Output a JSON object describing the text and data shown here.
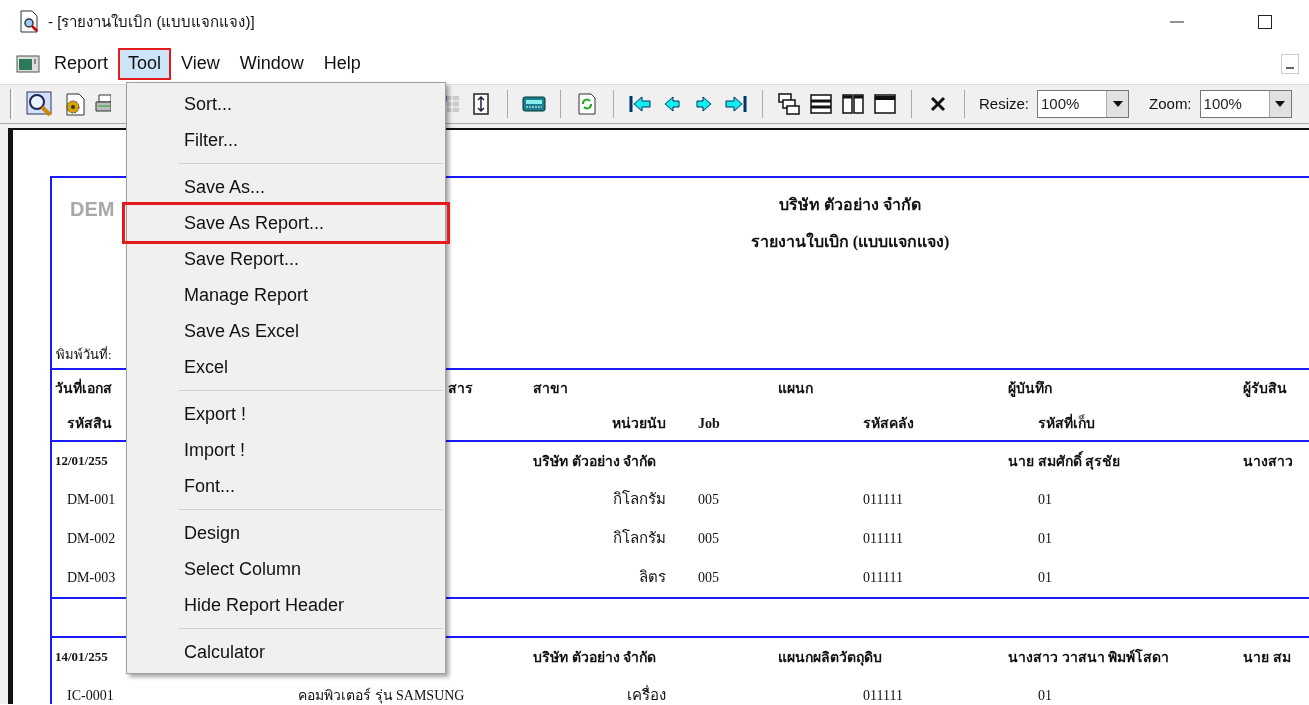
{
  "window": {
    "title": "- [รายงานใบเบิก (แบบแจกแจง)]"
  },
  "menu_bar": {
    "items": [
      {
        "label": "Report",
        "selected": false,
        "highlighted": false
      },
      {
        "label": "Tool",
        "selected": true,
        "highlighted": true
      },
      {
        "label": "View",
        "selected": false,
        "highlighted": false
      },
      {
        "label": "Window",
        "selected": false,
        "highlighted": false
      },
      {
        "label": "Help",
        "selected": false,
        "highlighted": false
      }
    ]
  },
  "dropdown_menu": {
    "items": [
      {
        "kind": "item",
        "label": "Sort...",
        "highlighted": false
      },
      {
        "kind": "item",
        "label": "Filter...",
        "highlighted": false
      },
      {
        "kind": "separator"
      },
      {
        "kind": "item",
        "label": "Save As...",
        "highlighted": false
      },
      {
        "kind": "item",
        "label": "Save As Report...",
        "highlighted": true
      },
      {
        "kind": "item",
        "label": "Save Report...",
        "highlighted": false
      },
      {
        "kind": "item",
        "label": "Manage Report",
        "highlighted": false
      },
      {
        "kind": "item",
        "label": "Save As Excel",
        "highlighted": false
      },
      {
        "kind": "item",
        "label": "Excel",
        "highlighted": false
      },
      {
        "kind": "separator"
      },
      {
        "kind": "item",
        "label": "Export !",
        "highlighted": false
      },
      {
        "kind": "item",
        "label": "Import !",
        "highlighted": false
      },
      {
        "kind": "item",
        "label": "Font...",
        "highlighted": false
      },
      {
        "kind": "separator"
      },
      {
        "kind": "item",
        "label": "Design",
        "highlighted": false
      },
      {
        "kind": "item",
        "label": "Select Column",
        "highlighted": false
      },
      {
        "kind": "item",
        "label": "Hide Report Header",
        "highlighted": false
      },
      {
        "kind": "separator"
      },
      {
        "kind": "item",
        "label": "Calculator",
        "highlighted": false
      }
    ]
  },
  "toolbar": {
    "resize": {
      "label": "Resize:",
      "value": "100%"
    },
    "zoom": {
      "label": "Zoom:",
      "value": "100%"
    }
  },
  "report": {
    "logo_text": "DEM",
    "company": "บริษัท ตัวอย่าง จำกัด",
    "title": "รายงานใบเบิก (แบบแจกแจง)",
    "print_date_label": "พิมพ์วันที่:",
    "header_rows": [
      {
        "column_1": "วันที่เอกส",
        "column_2": "สาร",
        "branch": "สาขา",
        "department": "แผนก",
        "recorder": "ผู้บันทึก",
        "column_7": "ผู้รับสิน"
      },
      {
        "column_1_sub": "รหัสสิน",
        "unit": "หน่วยนับ",
        "job": "Job",
        "warehouse_code": "รหัสคลัง",
        "location_code": "รหัสที่เก็บ"
      }
    ],
    "groups": [
      {
        "header": {
          "date": "12/01/255",
          "branch": "บริษัท ตัวอย่าง จำกัด",
          "recorder": "นาย สมศักดิ์  สุรชัย",
          "receiver": "นางสาว"
        },
        "lines": [
          {
            "code": "DM-001",
            "unit": "กิโลกรัม",
            "job": "005",
            "warehouse_code": "011111",
            "location_code": "01"
          },
          {
            "code": "DM-002",
            "unit": "กิโลกรัม",
            "job": "005",
            "warehouse_code": "011111",
            "location_code": "01"
          },
          {
            "code": "DM-003",
            "unit": "ลิตร",
            "job": "005",
            "warehouse_code": "011111",
            "location_code": "01"
          }
        ]
      },
      {
        "header": {
          "date": "14/01/255",
          "branch": "บริษัท ตัวอย่าง จำกัด",
          "department": "แผนกผลิตวัตถุดิบ",
          "recorder": "นางสาว วาสนา  พิมพ์โสดา",
          "receiver": "นาย สม"
        },
        "lines": [
          {
            "code": "IC-0001",
            "description": "คอมพิวเตอร์ รุ่น SAMSUNG",
            "unit": "เครื่อง",
            "warehouse_code": "011111",
            "location_code": "01"
          }
        ]
      }
    ]
  }
}
